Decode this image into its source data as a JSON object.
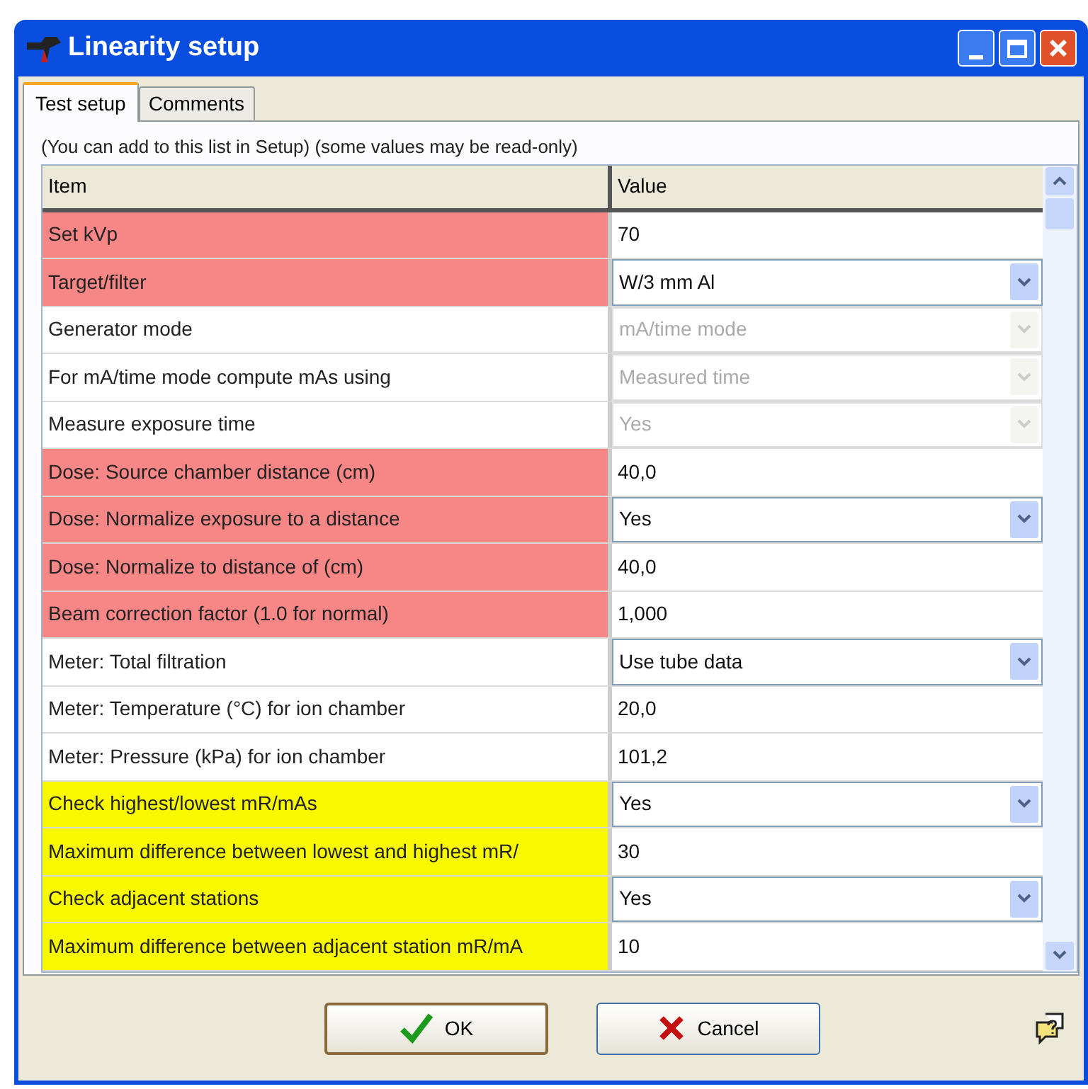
{
  "window": {
    "title": "Linearity setup"
  },
  "tabs": [
    {
      "label": "Test setup",
      "selected": true
    },
    {
      "label": "Comments",
      "selected": false
    }
  ],
  "note": "(You can add to this list in Setup)   (some values may be read-only)",
  "table": {
    "columns": [
      "Item",
      "Value"
    ],
    "rows": [
      {
        "item": "Set kVp",
        "value": "70",
        "kind": "text",
        "color": "#f78686",
        "disabled": false
      },
      {
        "item": "Target/filter",
        "value": "W/3 mm Al",
        "kind": "dropdown",
        "color": "#f78686",
        "disabled": false
      },
      {
        "item": "Generator mode",
        "value": "mA/time mode",
        "kind": "dropdown",
        "color": "#ffffff",
        "disabled": true
      },
      {
        "item": "For mA/time mode compute mAs using",
        "value": "Measured time",
        "kind": "dropdown",
        "color": "#ffffff",
        "disabled": true
      },
      {
        "item": "Measure exposure time",
        "value": "Yes",
        "kind": "dropdown",
        "color": "#ffffff",
        "disabled": true
      },
      {
        "item": "Dose:  Source chamber distance (cm)",
        "value": "40,0",
        "kind": "text",
        "color": "#f78686",
        "disabled": false
      },
      {
        "item": "Dose:  Normalize exposure to a distance",
        "value": "Yes",
        "kind": "dropdown",
        "color": "#f78686",
        "disabled": false
      },
      {
        "item": "Dose:  Normalize to distance of (cm)",
        "value": "40,0",
        "kind": "text",
        "color": "#f78686",
        "disabled": false
      },
      {
        "item": "Beam correction factor (1.0 for normal)",
        "value": "1,000",
        "kind": "text",
        "color": "#f78686",
        "disabled": false
      },
      {
        "item": "Meter:  Total filtration",
        "value": "Use tube data",
        "kind": "dropdown",
        "color": "#ffffff",
        "disabled": false
      },
      {
        "item": "Meter:  Temperature (°C) for ion chamber",
        "value": "20,0",
        "kind": "text",
        "color": "#ffffff",
        "disabled": false
      },
      {
        "item": "Meter:  Pressure (kPa) for ion chamber",
        "value": "101,2",
        "kind": "text",
        "color": "#ffffff",
        "disabled": false
      },
      {
        "item": "Check highest/lowest mR/mAs",
        "value": "Yes",
        "kind": "dropdown",
        "color": "#f8f800",
        "disabled": false
      },
      {
        "item": "Maximum difference between lowest and highest mR/",
        "value": "30",
        "kind": "text",
        "color": "#f8f800",
        "disabled": false
      },
      {
        "item": "Check adjacent stations",
        "value": "Yes",
        "kind": "dropdown",
        "color": "#f8f800",
        "disabled": false
      },
      {
        "item": "Maximum difference between adjacent station mR/mA",
        "value": "10",
        "kind": "text",
        "color": "#f8f800",
        "disabled": false
      }
    ]
  },
  "buttons": [
    {
      "label": "OK",
      "kind": "ok"
    },
    {
      "label": "Cancel",
      "kind": "cancel"
    }
  ]
}
